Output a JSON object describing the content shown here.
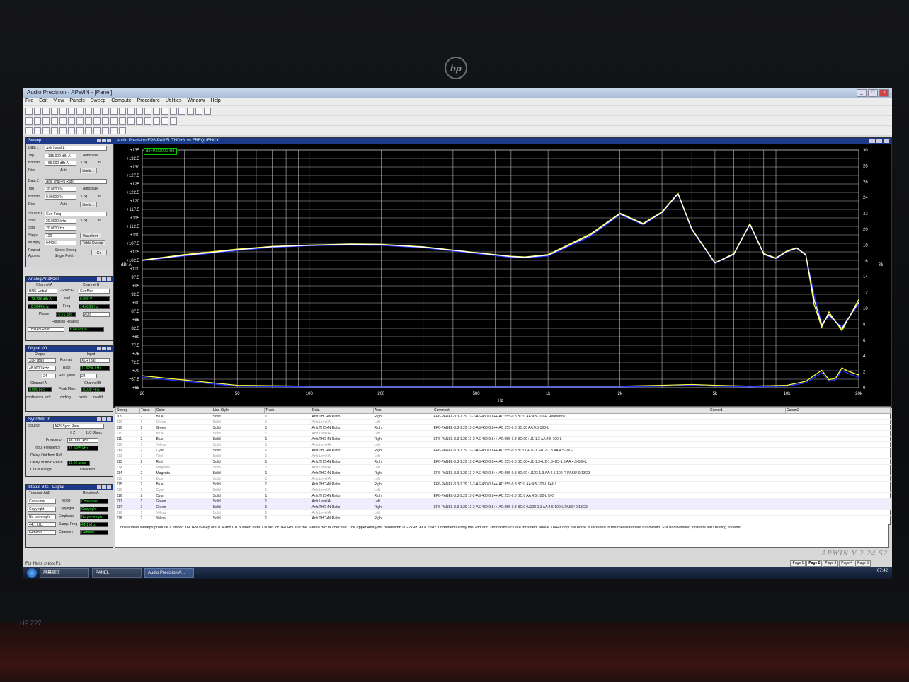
{
  "app": {
    "title": "Audio Precision - APWIN - [Panel]",
    "menu": [
      "File",
      "Edit",
      "View",
      "Panels",
      "Sweep",
      "Compute",
      "Procedure",
      "Utilities",
      "Window",
      "Help"
    ],
    "status": "For Help, press F1",
    "watermark": "APWIN V 2.24 S2",
    "pages": [
      "Page 1",
      "Page 2",
      "Page 3",
      "Page 4",
      "Page 5"
    ],
    "active_page": "Page 2"
  },
  "sweep_panel": {
    "title": "Sweep",
    "data1_label": "Data 1",
    "data1": "Anlr Level A",
    "top_label": "Top",
    "top": "+135.000 dBr A",
    "bottom_label": "Bottom",
    "bottom": "+65.000 dBr A",
    "div_label": "Divs",
    "auto": "Auto",
    "autoscale": "Autoscale",
    "log": "Log",
    "lin": "Lin",
    "limits": "Limits...",
    "data2_label": "Data 2",
    "data2": "Anlr THD+N Ratio",
    "top2": "30.0000 %",
    "bottom2": "0.00000 %",
    "source1_label": "Source 1",
    "source1": "Gen Freq",
    "start_label": "Start",
    "start": "20.0000 kHz",
    "stop_label": "Stop",
    "stop": "20.0000 Hz",
    "steps_label": "Steps",
    "steps": "120",
    "multiply_label": "Multiply",
    "multiply": "944061",
    "waveform": "Waveform",
    "table_sweep": "Table Sweep",
    "repeat": "Repeat",
    "append": "Append",
    "stereo_sweep": "Stereo Sweep",
    "single_point": "Single Point",
    "go": "Go"
  },
  "analyzer_panel": {
    "title": "Analog Analyzer",
    "channel_a": "Channel A",
    "channel_b": "Channel B",
    "input_a": "BNC-Unbal",
    "input_b": "GenMon",
    "source_label": "-Source-",
    "level_label": "Level",
    "level_a": "+73.738 dBr A",
    "level_b": "0.000 V",
    "freq_label": "Freq",
    "freq_a": "16.5944 kHz",
    "freq_b": "14.0336 Hz",
    "phase_label": "Phase",
    "phase": "-0.76 deg",
    "phase_mode": "Auto",
    "func_label": "Function Reading",
    "func": "THD+N Ratio",
    "func_value": "6.48123 %"
  },
  "dio_panel": {
    "title": "Digital I/O",
    "output": "Output",
    "input": "Input",
    "out_fmt": "XLR (bal)",
    "in_fmt": "XLR (bal)",
    "format_label": "Format",
    "out_rate": "48.0000 kHz",
    "in_rate": "11.9296 kHz",
    "rate_label": "Rate",
    "res_label": "Res. (bits)",
    "out_res": "24",
    "in_res": "24",
    "peak_label": "Peak Mon.",
    "peak_a": "0.000 FFS",
    "peak_b": "0.000 FFS",
    "conf": "confidence",
    "lock": "lock",
    "coding": "coding",
    "parity": "parity",
    "invalid": "invalid"
  },
  "sync_panel": {
    "title": "Sync/Ref In",
    "source_label": "Source",
    "source": "AES Sync Rate",
    "hiz": "Hi Z",
    "ohms": "110 Ohms",
    "freq_label": "Frequency",
    "freq": "48.0000 kHz",
    "input_freq_label": "Input Frequency",
    "input_freq": "11.1685 kHz",
    "delay_label": "Delay, Out from Ref",
    "delay2_label": "Delay, In from Ref In",
    "delay2": "11.06 usec",
    "oor_label": "Out of Range",
    "unlocked": "Unlocked"
  },
  "status_panel": {
    "title": "Status Bits - Digital",
    "transmit": "Transmit A&B",
    "receive": "Receive A:",
    "mode_label": "Mode",
    "mode_t": "Consumer",
    "mode_r": "Consumer",
    "copy_label": "Copyright",
    "copy_t": "Copyright",
    "copy_r": "Copyright",
    "emph_label": "Emphasis",
    "emph_t": "No pre-emph.",
    "emph_r": "No pre-emph.",
    "samp_label": "Samp. Freq",
    "samp_t": "44.1 kHz",
    "samp_r": "44.1 kHz",
    "cat_label": "Category",
    "cat_t": "General",
    "cat_r": "General"
  },
  "graph": {
    "title": "Audio Precision  EP6-PANEL THD+N  vs FREQUENCY",
    "cursor": "dx=0.00000 Hz",
    "xlabel": "Hz",
    "ylabel_left": "dBr A",
    "ylabel_right": "%"
  },
  "chart_data": {
    "type": "line",
    "xscale": "log",
    "xlim": [
      20,
      20000
    ],
    "xticks": [
      20,
      50,
      100,
      200,
      500,
      "1k",
      "2k",
      "5k",
      "10k",
      "20k"
    ],
    "ylim_left": [
      65,
      135
    ],
    "yticks_left": [
      "+135",
      "+132.5",
      "+130",
      "+127.5",
      "+125",
      "+122.5",
      "+120",
      "+117.5",
      "+115",
      "+112.5",
      "+110",
      "+107.5",
      "+105",
      "+102.5",
      "+100",
      "+97.5",
      "+95",
      "+92.5",
      "+90",
      "+87.5",
      "+85",
      "+82.5",
      "+80",
      "+77.5",
      "+75",
      "+72.5",
      "+70",
      "+67.5",
      "+65"
    ],
    "ylim_right": [
      0,
      30
    ],
    "yticks_right": [
      "30",
      "28",
      "26",
      "24",
      "22",
      "20",
      "18",
      "16",
      "14",
      "12",
      "10",
      "8",
      "6",
      "4",
      "2",
      "0"
    ],
    "grid": true,
    "background": "#000000",
    "series": [
      {
        "color": "#2233ff",
        "axis": "left",
        "x": [
          20,
          30,
          50,
          70,
          100,
          150,
          200,
          300,
          500,
          700,
          800,
          1000,
          1500,
          2000,
          2500,
          3000,
          3500,
          4000,
          5000,
          6000,
          7000,
          8000,
          9000,
          10000,
          11000,
          12000,
          13000,
          14000,
          15000,
          17000,
          20000
        ],
        "y": [
          102.4,
          103.8,
          105.4,
          106.3,
          106.8,
          107.0,
          106.9,
          106.2,
          104.5,
          103.4,
          103.2,
          103.8,
          109.5,
          116.0,
          113.0,
          116.5,
          122.0,
          111.5,
          101.6,
          104.2,
          113.0,
          104.2,
          103.0,
          105.0,
          106.0,
          104.0,
          92.5,
          84.0,
          86.0,
          83.0,
          89.5
        ]
      },
      {
        "color": "#ffff40",
        "axis": "left",
        "x": [
          20,
          30,
          50,
          70,
          100,
          150,
          200,
          300,
          500,
          700,
          800,
          1000,
          1500,
          2000,
          2500,
          3000,
          3500,
          4000,
          5000,
          6000,
          7000,
          8000,
          9000,
          10000,
          11000,
          12000,
          13000,
          14000,
          15000,
          17000,
          20000
        ],
        "y": [
          102.6,
          104.2,
          105.8,
          106.6,
          107.0,
          107.3,
          107.2,
          106.5,
          104.8,
          103.7,
          103.5,
          104.2,
          110.2,
          116.4,
          113.4,
          116.8,
          122.3,
          111.8,
          101.8,
          104.5,
          113.3,
          104.5,
          103.2,
          105.3,
          106.2,
          104.2,
          89.5,
          82.8,
          87.3,
          81.8,
          91.0
        ]
      },
      {
        "color": "#ffffff",
        "axis": "left",
        "x": [
          20,
          30,
          50,
          70,
          100,
          150,
          200,
          300,
          500,
          700,
          800,
          1000,
          1500,
          2000,
          2500,
          3000,
          3500,
          4000,
          5000,
          6000,
          7000,
          8000,
          9000,
          10000,
          11000,
          12000,
          13000,
          14000,
          15000,
          17000,
          20000
        ],
        "y": [
          102.5,
          104.0,
          105.6,
          106.5,
          106.9,
          107.2,
          107.1,
          106.4,
          104.7,
          103.6,
          103.4,
          104.0,
          109.9,
          116.2,
          113.2,
          116.6,
          122.1,
          111.6,
          101.7,
          104.3,
          113.1,
          104.3,
          103.1,
          105.1,
          106.1,
          104.1,
          91.0,
          83.4,
          86.6,
          82.4,
          90.2
        ]
      },
      {
        "color": "#ffff40",
        "axis": "right",
        "x": [
          20,
          50,
          100,
          200,
          500,
          1000,
          2000,
          3000,
          4000,
          5000,
          7000,
          10000,
          12000,
          14000,
          15000,
          16000,
          17000,
          18000,
          20000
        ],
        "y": [
          1.5,
          0.3,
          0.2,
          0.2,
          0.2,
          0.2,
          0.2,
          0.3,
          0.4,
          0.3,
          0.2,
          0.3,
          0.8,
          2.2,
          1.0,
          1.2,
          2.5,
          2.1,
          1.6
        ]
      },
      {
        "color": "#2233ff",
        "axis": "right",
        "x": [
          20,
          50,
          100,
          200,
          500,
          1000,
          2000,
          3000,
          4000,
          5000,
          7000,
          10000,
          12000,
          14000,
          15000,
          16000,
          17000,
          18000,
          20000
        ],
        "y": [
          1.3,
          0.2,
          0.1,
          0.1,
          0.1,
          0.1,
          0.1,
          0.2,
          0.3,
          0.2,
          0.1,
          0.2,
          0.6,
          1.9,
          0.8,
          1.0,
          2.2,
          1.8,
          1.3
        ]
      }
    ]
  },
  "table": {
    "headers": [
      "Sweep",
      "Trace",
      "Color",
      "Line Style",
      "Thick",
      "Data",
      "Axis",
      "Comment",
      "Cursor1",
      "Cursor2"
    ],
    "rows": [
      [
        "109",
        "2",
        "Blue",
        "Solid",
        "1",
        "Anlr.THD+N Ratio",
        "Right",
        "EP6-PANEL-3.3-1.29 11-2-AS:480-0.8++ AC:255-0.8 BC:0 AA:4.5-100-R Reference"
      ],
      [
        "110",
        "1",
        "Green",
        "Solid",
        "1",
        "Anlr.Level A",
        "Left",
        ""
      ],
      [
        "110",
        "2",
        "Green",
        "Solid",
        "1",
        "Anlr.THD+N Ratio",
        "Right",
        "EP6-PANEL-3.3-1.29 11-2-AS:480-0.8++ AC:255-0.8 BC:00 AA:4.5-100-L"
      ],
      [
        "111",
        "1",
        "Blue",
        "Solid",
        "1",
        "Anlr.Level A",
        "Left",
        ""
      ],
      [
        "111",
        "2",
        "Blue",
        "Solid",
        "1",
        "Anlr.THD+N Ratio",
        "Right",
        "EP6-PANEL-3.3-1.29 11-2-AS:480-0.8++ AC:255-0.8 BC:00+U1-1.3 AA:4.5-100-L"
      ],
      [
        "112",
        "1",
        "Yellow",
        "Solid",
        "1",
        "Anlr.Level A",
        "Left",
        ""
      ],
      [
        "112",
        "2",
        "Cyan",
        "Solid",
        "1",
        "Anlr.THD+N Ratio",
        "Right",
        "EP6-PANEL-3.3-1.29 11-2-AS:480-0.8++ AC:255-0.8 BC:00+U1-1.3+U2-1.3 AA:4.5-100-L"
      ],
      [
        "113",
        "1",
        "Red",
        "Solid",
        "1",
        "Anlr.Level A",
        "Left",
        ""
      ],
      [
        "113",
        "2",
        "Red",
        "Solid",
        "1",
        "Anlr.THD+N Ratio",
        "Right",
        "EP6-PANEL-3.3-1.29 11-2-AS:480-0.8++ AC:255-0.8 BC:00+U1-1.3+U2-1.3+U3-1.3 AA:4.5-100-L"
      ],
      [
        "114",
        "1",
        "Magenta",
        "Solid",
        "1",
        "Anlr.Level A",
        "Left",
        ""
      ],
      [
        "114",
        "2",
        "Magenta",
        "Solid",
        "1",
        "Anlr.THD+N Ratio",
        "Right",
        "EP6-PANEL-3.3-1.29 11-2-AS:480-0.8++ AC:255-0.8 BC:00+U123-1.3 AA:4.5-100-R PASS! 9/13/23"
      ],
      [
        "115",
        "1",
        "Blue",
        "Solid",
        "1",
        "Anlr.Level A",
        "Left",
        ""
      ],
      [
        "115",
        "2",
        "Blue",
        "Solid",
        "1",
        "Anlr.THD+N Ratio",
        "Right",
        "EP6-PANEL-3.3-1.29 11-2-AS:480-0.8++ AC:255-0.8 BC:0 AA:4.5-100-L FAIL!"
      ],
      [
        "116",
        "1",
        "Cyan",
        "Solid",
        "1",
        "Anlr.Level A",
        "Left",
        ""
      ],
      [
        "116",
        "2",
        "Cyan",
        "Solid",
        "1",
        "Anlr.THD+N Ratio",
        "Right",
        "EP6-PANEL-3.3-1.29 11-2-AS:480-0.8++ AC:255-0.8 BC:0 AA:4.5-100-L OK!"
      ],
      [
        "117",
        "1",
        "Green",
        "Solid",
        "1",
        "Anlr.Level A",
        "Left",
        ""
      ],
      [
        "117",
        "2",
        "Green",
        "Solid",
        "1",
        "Anlr.THD+N Ratio",
        "Right",
        "EP6-PANEL-3.3-1.29 11-2-AS:480-0.8++ AC:255-0.8 BC:0+U123-1.3 AA:4.5-100-L PASS! 9/13/23"
      ],
      [
        "118",
        "1",
        "Yellow",
        "Solid",
        "1",
        "Anlr.Level A",
        "Left",
        ""
      ],
      [
        "118",
        "2",
        "Yellow",
        "Solid",
        "1",
        "Anlr.THD+N Ratio",
        "Right",
        ""
      ]
    ]
  },
  "description": "Consecutive sweeps produce a stereo THD+N sweep of Ch A and Ch B when data 1 is set for THD+N and the Stereo box is checked. The upper Analyzer bandwidth is 22kHz. At a 7kHz fundamental only the 2nd and 3rd harmonics are included, above 11kHz only the noise is included in the measurement bandwidth. For band-limited systems IMD testing is better.",
  "taskbar": {
    "items": [
      "屏幕捕获",
      "PANEL",
      "Audio Precision A..."
    ],
    "time": "07:42"
  },
  "monitor": {
    "brand": "hp",
    "model": "HP Z27"
  }
}
